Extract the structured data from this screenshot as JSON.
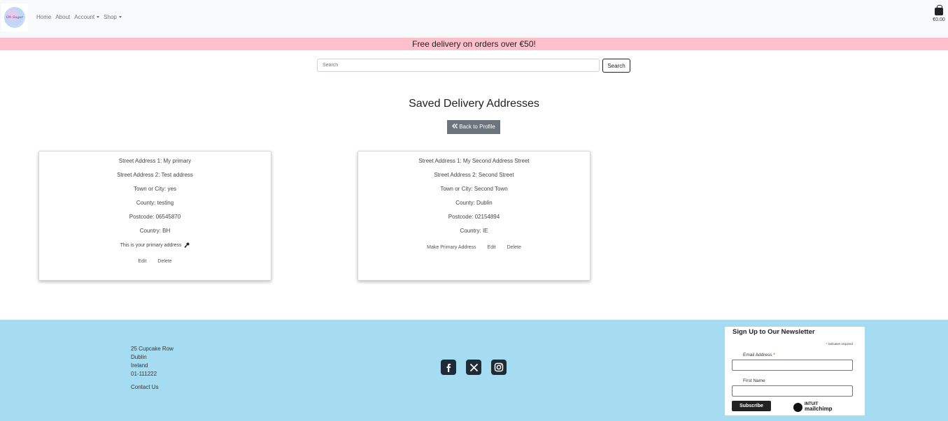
{
  "nav": {
    "logo_text": "Oh Sugar",
    "links": [
      "Home",
      "About",
      "Account",
      "Shop"
    ],
    "cart_total": "€0.00"
  },
  "banner": {
    "text": "Free delivery on orders over €50!"
  },
  "search": {
    "placeholder": "Search",
    "button": "Search"
  },
  "page": {
    "title": "Saved Delivery Addresses",
    "back_button": "Back to Profile"
  },
  "addresses": [
    {
      "street1": "Street Address 1: My primary",
      "street2": "Street Address 2: Test address",
      "town": "Town or City: yes",
      "county": "County: testing",
      "postcode": "Postcode: 06545870",
      "country": "Country: BH",
      "primary_note": "This is your primary address",
      "edit": "Edit",
      "delete": "Delete"
    },
    {
      "street1": "Street Address 1: My Second Address Street",
      "street2": "Street Address 2: Second Street",
      "town": "Town or City: Second Town",
      "county": "County: Dublin",
      "postcode": "Postcode: 02154894",
      "country": "Country: IE",
      "make_primary": "Make Primary Address",
      "edit": "Edit",
      "delete": "Delete"
    }
  ],
  "footer": {
    "address_lines": [
      "25 Cupcake Row",
      "Dublin",
      "Ireland",
      "01-111222"
    ],
    "contact": "Contact Us",
    "social_icons": [
      "facebook-icon",
      "x-icon",
      "instagram-icon"
    ]
  },
  "newsletter": {
    "title": "Sign Up to Our Newsletter",
    "required_note": "indicates required",
    "email_label": "Email Address",
    "first_name_label": "First Name",
    "subscribe": "Subscribe",
    "brand_top": "INTUIT",
    "brand_bottom": "mailchimp"
  },
  "colors": {
    "navbar_bg": "#f8f9fa",
    "banner_bg": "#ffc0cb",
    "footer_bg": "#a6dcf2",
    "back_button_bg": "#6c757d"
  }
}
